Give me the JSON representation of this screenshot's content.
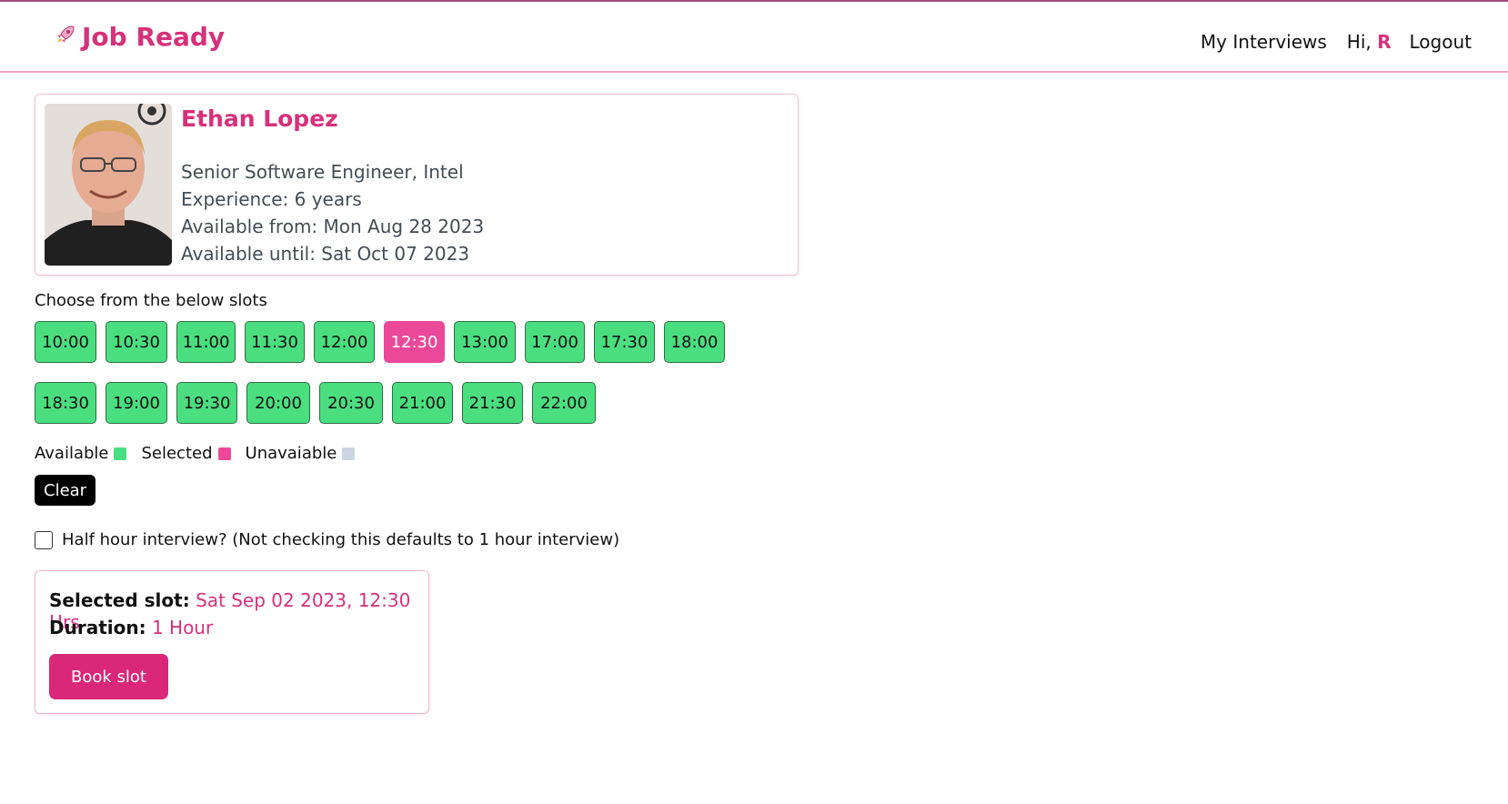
{
  "colors": {
    "accent": "#d6317a",
    "available": "#4ade80",
    "selected": "#ec4899",
    "unavailable": "#cbd5e1",
    "book_button": "#db2777"
  },
  "navbar": {
    "brand_icon": "rocket-icon",
    "brand": "Job Ready",
    "my_interviews": "My Interviews",
    "greeting": "Hi, ",
    "user_initial": "R",
    "logout": "Logout"
  },
  "profile": {
    "name": "Ethan Lopez",
    "role": "Senior Software Engineer, Intel",
    "experience": "Experience: 6 years",
    "available_from": "Available from: Mon Aug 28 2023",
    "available_until": "Available until: Sat Oct 07 2023"
  },
  "slots": {
    "label": "Choose from the below slots",
    "row1": [
      {
        "time": "10:00",
        "state": "available"
      },
      {
        "time": "10:30",
        "state": "available"
      },
      {
        "time": "11:00",
        "state": "available"
      },
      {
        "time": "11:30",
        "state": "available"
      },
      {
        "time": "12:00",
        "state": "available"
      },
      {
        "time": "12:30",
        "state": "selected"
      },
      {
        "time": "13:00",
        "state": "available"
      },
      {
        "time": "17:00",
        "state": "available"
      },
      {
        "time": "17:30",
        "state": "available"
      },
      {
        "time": "18:00",
        "state": "available"
      }
    ],
    "row2": [
      {
        "time": "18:30",
        "state": "available"
      },
      {
        "time": "19:00",
        "state": "available"
      },
      {
        "time": "19:30",
        "state": "available"
      },
      {
        "time": "20:00",
        "state": "available"
      },
      {
        "time": "20:30",
        "state": "available"
      },
      {
        "time": "21:00",
        "state": "available"
      },
      {
        "time": "21:30",
        "state": "available"
      },
      {
        "time": "22:00",
        "state": "available"
      }
    ]
  },
  "legend": {
    "available": "Available",
    "selected": "Selected",
    "unavailable": "Unavaiable"
  },
  "clear_label": "Clear",
  "half_hour": {
    "label": "Half hour interview? (Not checking this defaults to 1 hour interview)",
    "checked": false
  },
  "summary": {
    "slot_key": "Selected slot:",
    "slot_value": "Sat Sep 02 2023, 12:30 Hrs",
    "duration_key": "Duration:",
    "duration_value": "1 Hour",
    "book_label": "Book slot"
  }
}
